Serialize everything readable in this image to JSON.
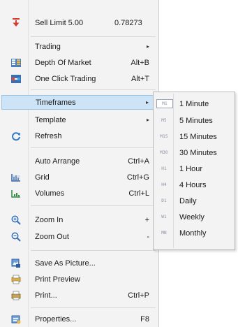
{
  "menu": {
    "sell_limit": {
      "label": "Sell Limit 5.00",
      "price": "0.78273",
      "icon": "sell-arrow-icon",
      "color": "#d83a2e"
    },
    "trading": {
      "label": "Trading"
    },
    "depth_of_market": {
      "label": "Depth Of Market",
      "shortcut": "Alt+B",
      "icon": "depth-of-market-icon"
    },
    "one_click_trading": {
      "label": "One Click Trading",
      "shortcut": "Alt+T",
      "icon": "one-click-trading-icon"
    },
    "timeframes": {
      "label": "Timeframes"
    },
    "template": {
      "label": "Template"
    },
    "refresh": {
      "label": "Refresh",
      "icon": "refresh-icon"
    },
    "auto_arrange": {
      "label": "Auto Arrange",
      "shortcut": "Ctrl+A"
    },
    "grid": {
      "label": "Grid",
      "shortcut": "Ctrl+G",
      "icon": "grid-icon"
    },
    "volumes": {
      "label": "Volumes",
      "shortcut": "Ctrl+L",
      "icon": "volumes-icon"
    },
    "zoom_in": {
      "label": "Zoom In",
      "shortcut": "+",
      "icon": "zoom-in-icon"
    },
    "zoom_out": {
      "label": "Zoom Out",
      "shortcut": "-",
      "icon": "zoom-out-icon"
    },
    "save_as_picture": {
      "label": "Save As Picture...",
      "icon": "save-picture-icon"
    },
    "print_preview": {
      "label": "Print Preview",
      "icon": "print-preview-icon"
    },
    "print": {
      "label": "Print...",
      "shortcut": "Ctrl+P",
      "icon": "printer-icon"
    },
    "properties": {
      "label": "Properties...",
      "shortcut": "F8",
      "icon": "properties-icon"
    }
  },
  "submenu": {
    "items": [
      {
        "code": "M1",
        "label": "1 Minute"
      },
      {
        "code": "M5",
        "label": "5 Minutes"
      },
      {
        "code": "M15",
        "label": "15 Minutes"
      },
      {
        "code": "M30",
        "label": "30 Minutes"
      },
      {
        "code": "H1",
        "label": "1 Hour"
      },
      {
        "code": "H4",
        "label": "4 Hours"
      },
      {
        "code": "D1",
        "label": "Daily"
      },
      {
        "code": "W1",
        "label": "Weekly"
      },
      {
        "code": "MN",
        "label": "Monthly"
      }
    ]
  },
  "colors": {
    "highlight": "#cde4f7",
    "highlight_border": "#97c3e8",
    "menu_bg": "#f3f3f3"
  }
}
